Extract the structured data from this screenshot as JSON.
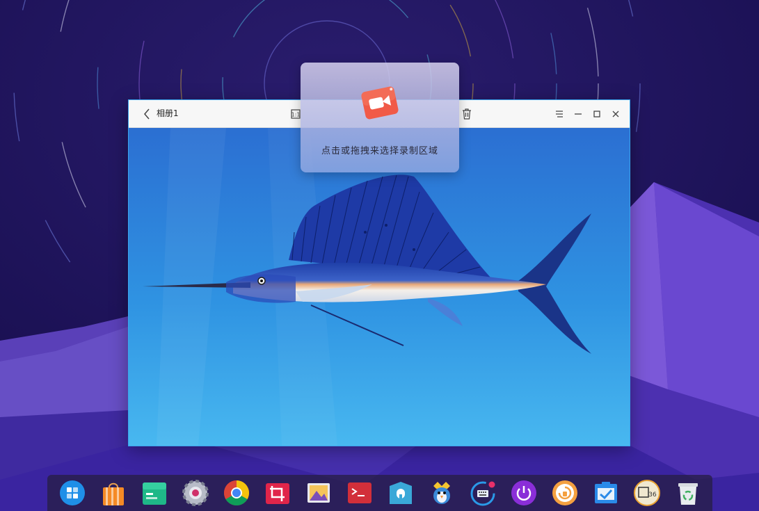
{
  "viewer": {
    "album_title": "相册1"
  },
  "recorder": {
    "hint": "点击或拖拽来选择录制区域"
  },
  "dock": {
    "items": [
      {
        "icon": "launcher-icon"
      },
      {
        "icon": "app-store-icon"
      },
      {
        "icon": "file-manager-icon"
      },
      {
        "icon": "settings-icon"
      },
      {
        "icon": "chrome-browser-icon"
      },
      {
        "icon": "screenshot-icon"
      },
      {
        "icon": "image-viewer-icon"
      },
      {
        "icon": "terminal-icon"
      },
      {
        "icon": "archive-manager-icon"
      },
      {
        "icon": "mascot-icon"
      },
      {
        "icon": "onboard-keyboard-icon"
      },
      {
        "icon": "power-icon"
      },
      {
        "icon": "backup-icon"
      },
      {
        "icon": "task-manager-icon"
      },
      {
        "icon": "calendar-icon",
        "text": "36"
      },
      {
        "icon": "trash-icon"
      }
    ]
  },
  "colors": {
    "window_border": "#3aa6ee",
    "titlebar_bg": "#f7f7f7",
    "recorder_accent": "#f15a47"
  }
}
